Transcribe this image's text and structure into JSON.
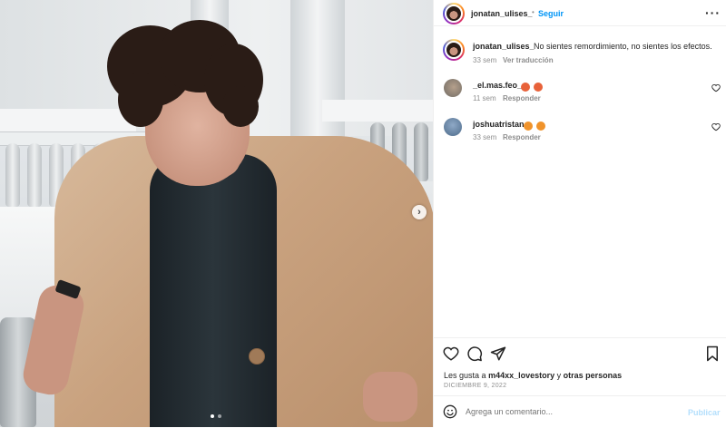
{
  "post": {
    "author": "jonatan_ulises_",
    "follow_label": "Seguir",
    "more_icon": "more-horizontal-icon",
    "caption_author": "jonatan_ulises_",
    "caption_text": "No sientes remordimiento, no sientes los efectos.",
    "caption_age": "33 sem",
    "translate_label": "Ver traducción"
  },
  "comments": [
    {
      "user": "_el.mas.feo_",
      "age": "11 sem",
      "reply_label": "Responder"
    },
    {
      "user": "joshuatristan",
      "age": "33 sem",
      "reply_label": "Responder"
    }
  ],
  "likes": {
    "prefix": "Les gusta a",
    "user": "m44xx_lovestory",
    "joiner": "y",
    "others": "otras personas"
  },
  "date_label": "DICIEMBRE 9, 2022",
  "composer": {
    "placeholder": "Agrega un comentario...",
    "publish_label": "Publicar"
  },
  "colors": {
    "accent": "#0095f6",
    "text": "#262626",
    "muted": "#8e8e8e"
  }
}
